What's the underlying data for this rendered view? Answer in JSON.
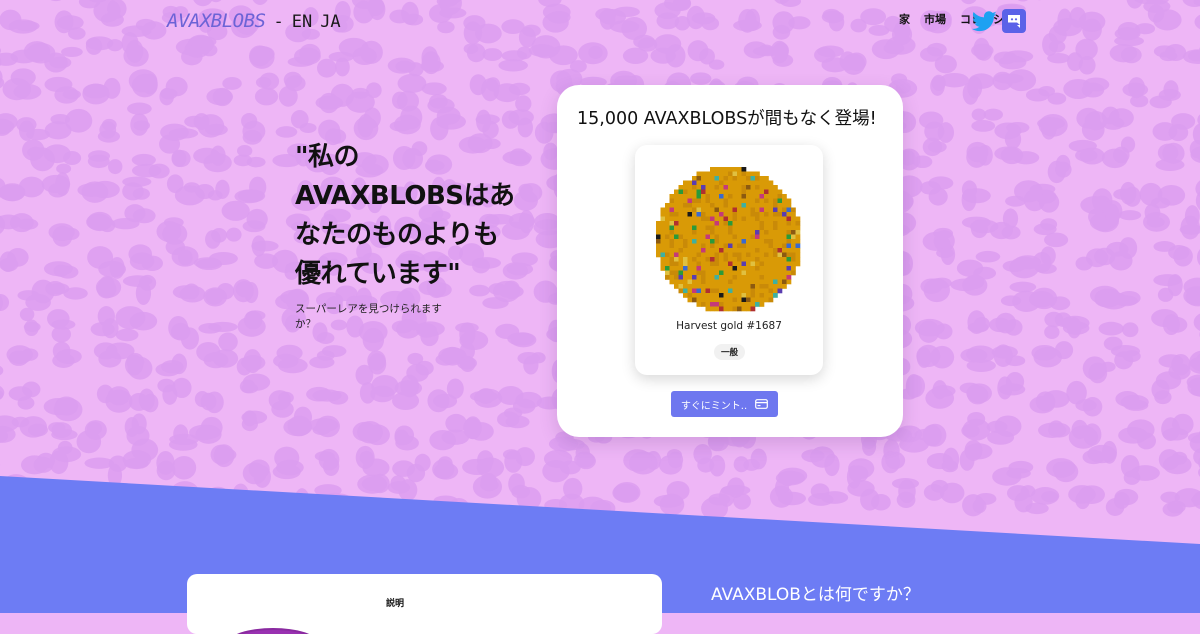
{
  "header": {
    "logo": "AVAXBLOBS",
    "separator": "-",
    "languages": [
      "EN",
      "JA"
    ],
    "nav": [
      "家",
      "市場",
      "コレクション"
    ],
    "social": [
      {
        "icon": "twitter-icon",
        "color": "#1da1f2"
      },
      {
        "icon": "discord-icon",
        "color": "#5b62e8"
      }
    ]
  },
  "hero": {
    "headline": "\"私の AVAXBLOBSはあなたのものよりも優れています\"",
    "tagline": "スーパーレアを見つけられますか？"
  },
  "mint": {
    "title": "15,000 AVAXBLOBSが間もなく登場!",
    "blob_name": "Harvest gold #1687",
    "rarity": "一般",
    "button_label": "すぐにミント..",
    "button_icon": "credit-card-icon"
  },
  "about": {
    "label": "説明",
    "heading": "AVAXBLOBとは何ですか？"
  },
  "colors": {
    "background_pink": "#eeb6f6",
    "pattern_purple": "#dc9df0",
    "accent_blue": "#6d7cf4",
    "blob_gold": "#d99a06"
  }
}
